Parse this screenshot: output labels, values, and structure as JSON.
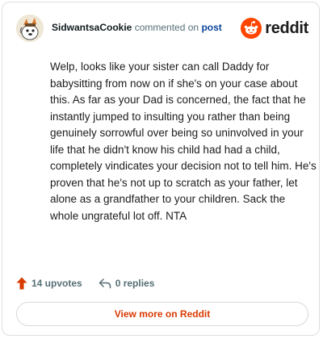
{
  "header": {
    "username": "SidwantsaCookie",
    "action_text": "commented on",
    "post_link": "post",
    "brand": "reddit"
  },
  "comment": {
    "body": "Welp, looks like your sister can call Daddy for babysitting from now on if she's on your case about this. As far as your Dad is concerned, the fact that he instantly jumped to insulting you rather than being genuinely sorrowful over being so uninvolved in your life that he didn't know his child had had a child, completely vindicates your decision not to tell him. He's proven that he's not up to scratch as your father, let alone as a grandfather to your children. Sack the whole ungrateful lot off. NTA"
  },
  "footer": {
    "upvotes": "14 upvotes",
    "replies": "0 replies"
  },
  "cta": {
    "view_more": "View more on Reddit"
  },
  "colors": {
    "brand_orange": "#ff4500",
    "upvote": "#d93a00",
    "link": "#0a449b"
  },
  "icons": [
    "avatar",
    "reddit-logo-icon",
    "upvote-arrow-icon",
    "reply-icon"
  ]
}
